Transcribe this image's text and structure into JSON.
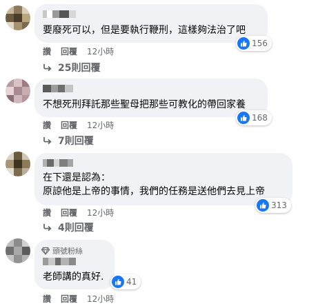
{
  "comments": [
    {
      "text": "要廢死可以，但是要執行鞭刑，這樣夠法治了吧",
      "reactions": "156",
      "actions": {
        "like": "讚",
        "reply": "回覆",
        "time": "12小時"
      },
      "replies_label": "25則回覆"
    },
    {
      "text": "不想死刑拜託那些聖母把那些可教化的帶回家養",
      "reactions": "168",
      "actions": {
        "like": "讚",
        "reply": "回覆",
        "time": "12小時"
      },
      "replies_label": "7則回覆"
    },
    {
      "text_line1": "在下還是認為：",
      "text_line2": "原諒他是上帝的事情，我們的任務是送他們去見上帝",
      "reactions": "313",
      "actions": {
        "like": "讚",
        "reply": "回覆",
        "time": "12小時"
      },
      "replies_label": "4則回覆"
    },
    {
      "badge": "頭號粉絲",
      "text": "老師講的真好.",
      "reactions": "41",
      "actions": {
        "like": "讚",
        "reply": "回覆",
        "time": "12小時"
      }
    }
  ],
  "colors": {
    "bubble": "#f0f2f5",
    "like_blue": "#1877f2",
    "meta_gray": "#65676b"
  },
  "icons": {
    "like": "thumbs-up-icon",
    "reply_arrow": "reply-arrow-icon",
    "badge": "diamond-icon"
  }
}
